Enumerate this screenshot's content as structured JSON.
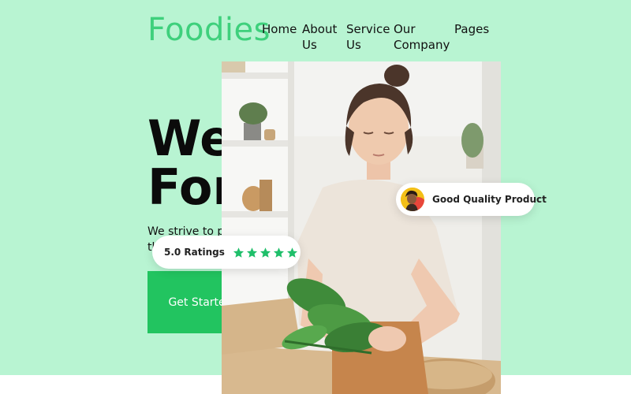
{
  "brand": {
    "logo": "Foodies",
    "accent": "#3ed07c",
    "hero_bg": "#b8f4d2",
    "cta_color": "#22c460"
  },
  "nav": {
    "items": [
      {
        "line1": "Home",
        "line2": ""
      },
      {
        "line1": "About",
        "line2": "Us"
      },
      {
        "line1": "Service",
        "line2": "Us"
      },
      {
        "line1": "Our",
        "line2": "Company"
      },
      {
        "line1": "Pages",
        "line2": ""
      }
    ]
  },
  "hero": {
    "headline_line1": "We",
    "headline_line2": "For",
    "subtext_line1": "We strive to pr",
    "subtext_line2": "th",
    "cta_label": "Get Started"
  },
  "badges": {
    "quality": {
      "label": "Good Quality Product",
      "avatar_icon": "customer-avatar"
    },
    "rating": {
      "label": "5.0 Ratings",
      "stars": 5,
      "star_color": "#1fbf6a",
      "star_icon": "star-icon"
    }
  },
  "photo": {
    "icon": "woman-with-greens-photo"
  }
}
